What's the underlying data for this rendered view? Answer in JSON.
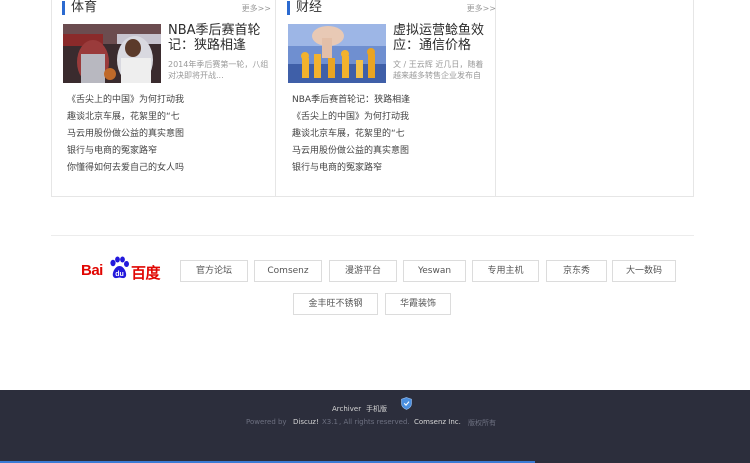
{
  "sections": [
    {
      "title": "体育",
      "more": "更多>>",
      "thumb_icon": "basketball-game-photo",
      "headline": "NBA季后赛首轮记：狭路相逢",
      "summary": "2014年季后赛第一轮，八组对决即将开战...",
      "list": [
        "《舌尖上的中国》为何打动我",
        "趣谈北京车展，花絮里的“七",
        "马云用股份做公益的真实意图",
        "银行与电商的冤家路窄",
        "你懂得如何去爱自己的女人吗"
      ]
    },
    {
      "title": "财经",
      "more": "更多>>",
      "thumb_icon": "finance-game-pieces-photo",
      "headline": "虚拟运营鲶鱼效应：通信价格",
      "summary": "文 / 王云辉 近几日，随着越来越多转售企业发布自",
      "list": [
        "NBA季后赛首轮记：狭路相逢",
        "《舌尖上的中国》为何打动我",
        "趣谈北京车展，花絮里的“七",
        "马云用股份做公益的真实意图",
        "银行与电商的冤家路窄"
      ]
    }
  ],
  "partner": {
    "logo_text_left": "Bai",
    "logo_text_right": "百度",
    "logo_icon": "baidu-paw-icon",
    "links": [
      "官方论坛",
      "Comsenz",
      "漫游平台",
      "Yeswan",
      "专用主机",
      "京东秀",
      "大一数码",
      "金丰旺不锈钢",
      "华霞装饰"
    ]
  },
  "footer": {
    "archiver": "Archiver",
    "mobile": "手机版",
    "powered_by": "Powered by",
    "discuz": "Discuz!",
    "version": "X3.1",
    "rights": ", All rights reserved.",
    "company": "Comsenz Inc.",
    "copyright": "版权所有",
    "shield_icon": "shield-icon"
  },
  "colors": {
    "accent": "#2b6ad0",
    "baidu_red": "#e10602",
    "baidu_blue": "#2319dc",
    "footer_bg": "#2c2e3c"
  }
}
